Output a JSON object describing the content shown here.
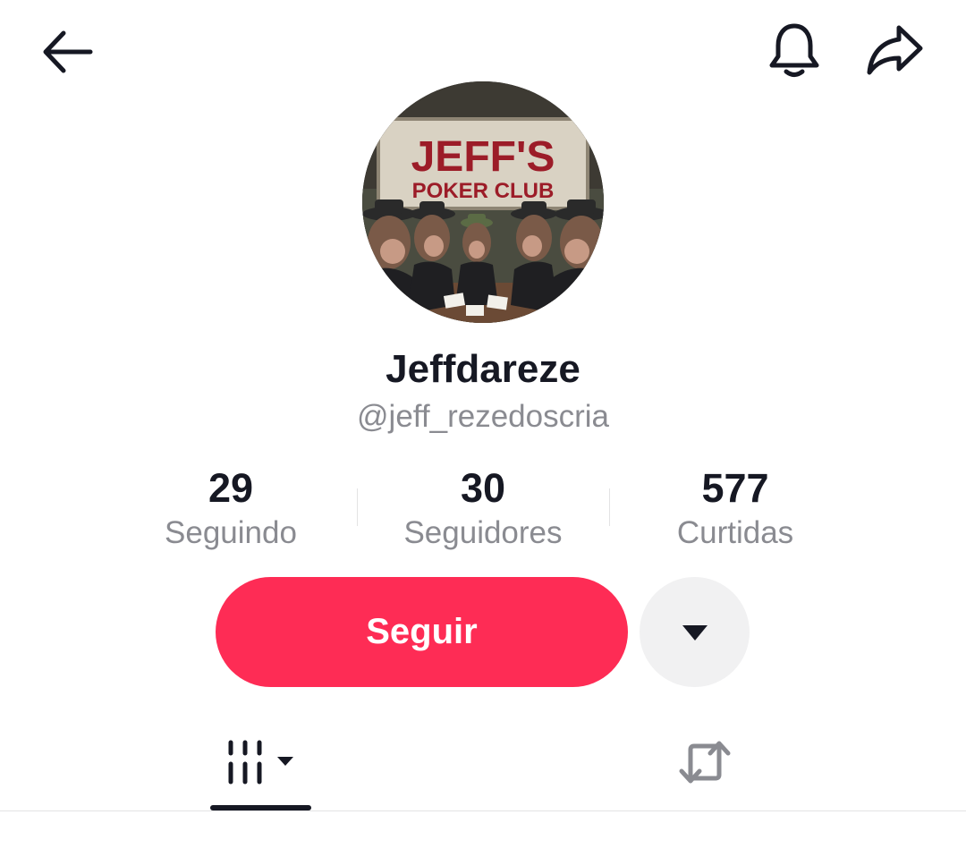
{
  "header": {
    "back_icon": "arrow-left-icon",
    "notification_icon": "bell-icon",
    "share_icon": "share-arrow-icon"
  },
  "profile": {
    "avatar_sign_line1": "JEFF'S",
    "avatar_sign_line2": "POKER CLUB",
    "display_name": "Jeffdareze",
    "username": "@jeff_rezedoscria"
  },
  "stats": [
    {
      "value": "29",
      "label": "Seguindo"
    },
    {
      "value": "30",
      "label": "Seguidores"
    },
    {
      "value": "577",
      "label": "Curtidas"
    }
  ],
  "actions": {
    "follow_label": "Seguir",
    "follow_color": "#fe2c55",
    "more_icon": "caret-down-icon"
  },
  "tabs": {
    "videos_icon": "grid-videos-icon",
    "reposts_icon": "repost-icon"
  }
}
